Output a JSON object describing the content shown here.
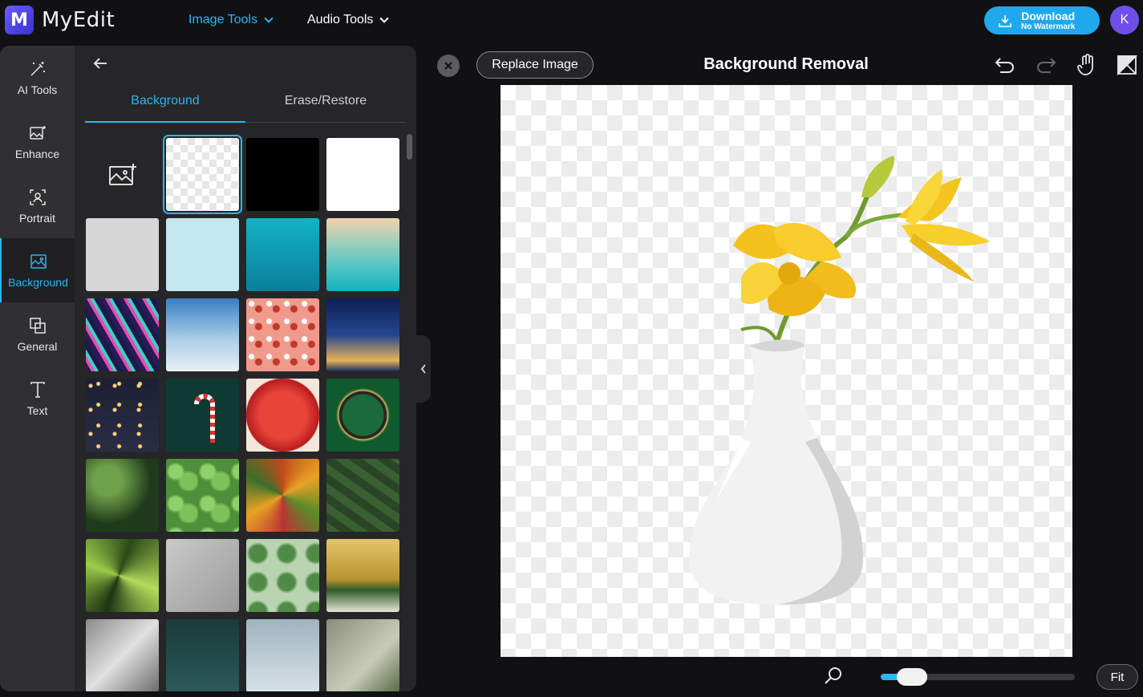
{
  "app": {
    "name": "MyEdit",
    "logo_letter": "M"
  },
  "topnav": {
    "image_tools": "Image Tools",
    "audio_tools": "Audio Tools",
    "download_label": "Download",
    "download_sub": "No Watermark",
    "avatar_letter": "K"
  },
  "sidebar": {
    "items": [
      {
        "label": "AI Tools",
        "icon": "magic-wand-icon"
      },
      {
        "label": "Enhance",
        "icon": "enhance-image-icon"
      },
      {
        "label": "Portrait",
        "icon": "portrait-icon"
      },
      {
        "label": "Background",
        "icon": "background-image-icon",
        "active": true
      },
      {
        "label": "General",
        "icon": "general-layers-icon"
      },
      {
        "label": "Text",
        "icon": "text-icon"
      }
    ]
  },
  "panel": {
    "tabs": [
      {
        "label": "Background",
        "active": true
      },
      {
        "label": "Erase/Restore",
        "active": false
      }
    ],
    "swatches": {
      "selected": "transparent",
      "colors": [
        "#000000",
        "#ffffff",
        "#d6d6d6",
        "#c5e8f0"
      ],
      "gradients": [
        "teal-blue",
        "sand-to-cyan"
      ]
    }
  },
  "editor": {
    "title": "Background Removal",
    "replace_label": "Replace Image",
    "fit_label": "Fit",
    "zoom_level": 0.1
  },
  "colors": {
    "accent": "#2ab6f0",
    "download": "#1fa8ec",
    "avatar": "#6f4fe8"
  }
}
